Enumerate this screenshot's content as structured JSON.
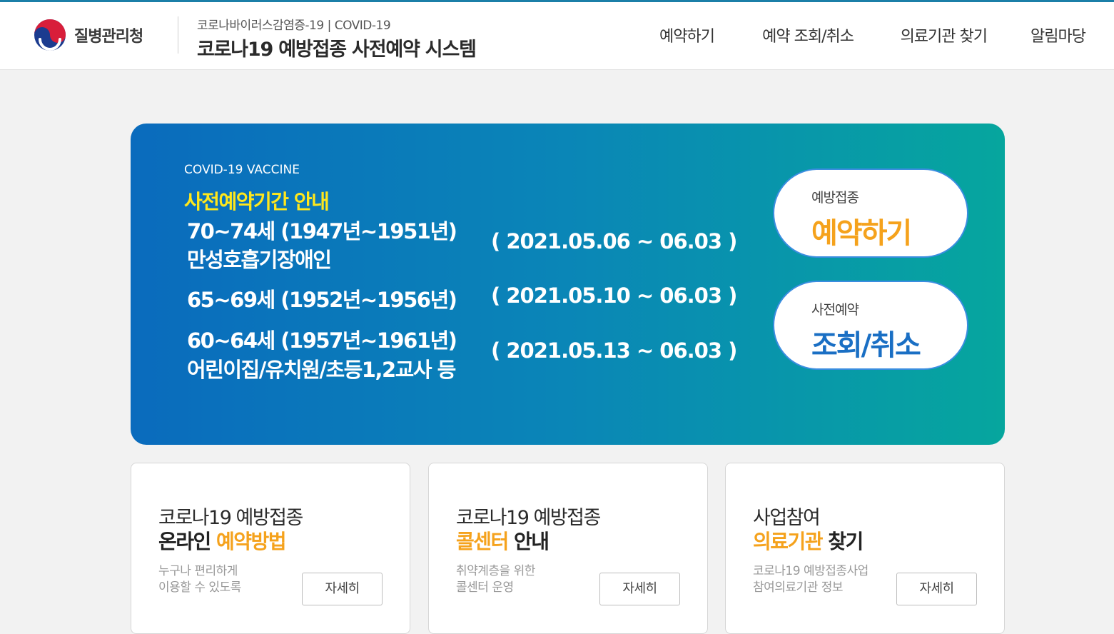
{
  "header": {
    "org_name": "질병관리청",
    "site_subtitle": "코로나바이러스감염증-19 | COVID-19",
    "site_title": "코로나19 예방접종 사전예약 시스템",
    "nav": [
      "예약하기",
      "예약 조회/취소",
      "의료기관 찾기",
      "알림마당"
    ]
  },
  "hero": {
    "kicker": "COVID-19 VACCINE",
    "heading": "사전예약기간 안내",
    "groups": [
      {
        "line1": "70~74세 (1947년~1951년)",
        "line2": "만성호흡기장애인",
        "date": "( 2021.05.06 ~ 06.03 )"
      },
      {
        "line1": "65~69세 (1952년~1956년)",
        "date": "( 2021.05.10 ~ 06.03 )"
      },
      {
        "line1": "60~64세 (1957년~1961년)",
        "line2": "어린이집/유치원/초등1,2교사 등",
        "date": "( 2021.05.13 ~ 06.03 )"
      }
    ],
    "buttons": [
      {
        "top": "예방접종",
        "main": "예약하기"
      },
      {
        "top": "사전예약",
        "main": "조회/취소"
      }
    ]
  },
  "cards": [
    {
      "line1": "코로나19 예방접종",
      "line2_a": "온라인 ",
      "line2_b": "예약방법",
      "desc1": "누구나 편리하게",
      "desc2": "이용할 수 있도록",
      "button": "자세히"
    },
    {
      "line1": "코로나19 예방접종",
      "line2_a": "콜센터",
      "line2_b": " 안내",
      "desc1": "취약계층을 위한",
      "desc2": "콜센터 운영",
      "button": "자세히"
    },
    {
      "line1": "사업참여",
      "line2_a": "의료기관",
      "line2_b": " 찾기",
      "desc1": "코로나19 예방접종사업",
      "desc2": "참여의료기관 정보",
      "button": "자세히"
    }
  ],
  "colors": {
    "accent_orange": "#f5a21c",
    "accent_blue": "#1a6fc4",
    "heading_yellow": "#ffe71c"
  },
  "icons": {
    "logo": "taegeuk-logo-icon"
  }
}
